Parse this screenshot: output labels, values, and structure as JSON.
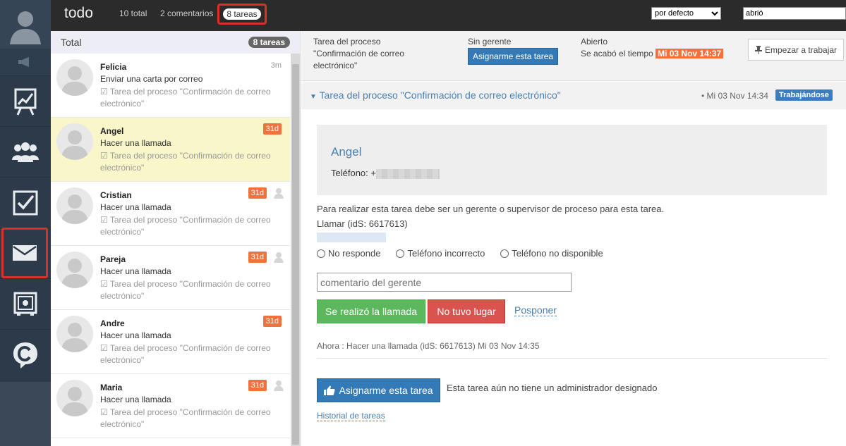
{
  "topbar": {
    "title": "todo",
    "total_label": "10 total",
    "comments_label": "2 comentarios",
    "tasks_label": "8 tareas",
    "sort_select_value": "por defecto",
    "search_value": "abrió"
  },
  "nav": {
    "items": [
      {
        "icon": "user-avatar-icon"
      },
      {
        "icon": "megaphone-icon"
      },
      {
        "icon": "chart-presentation-icon"
      },
      {
        "icon": "people-group-icon"
      },
      {
        "icon": "checkbox-icon"
      },
      {
        "icon": "envelope-icon",
        "active": true
      },
      {
        "icon": "safe-icon"
      },
      {
        "icon": "c-chat-icon"
      }
    ],
    "accent": "#d9302c"
  },
  "list": {
    "header_label": "Total",
    "header_count": "8 tareas",
    "items": [
      {
        "name": "Felicia",
        "action": "Enviar una carta por correo",
        "process": "Tarea del proceso \"Confirmación de correo electrónico\"",
        "time": "3m",
        "tag": "",
        "has_user_icon": false,
        "selected": false
      },
      {
        "name": "Angel",
        "action": "Hacer una llamada",
        "process": "Tarea del proceso \"Confirmación de correo electrónico\"",
        "time": "",
        "tag": "31d",
        "has_user_icon": false,
        "selected": true
      },
      {
        "name": "Cristian",
        "action": "Hacer una llamada",
        "process": "Tarea del proceso \"Confirmación de correo electrónico\"",
        "time": "",
        "tag": "31d",
        "has_user_icon": true,
        "selected": false
      },
      {
        "name": "Pareja",
        "action": "Hacer una llamada",
        "process": "Tarea del proceso \"Confirmación de correo electrónico\"",
        "time": "",
        "tag": "31d",
        "has_user_icon": true,
        "selected": false
      },
      {
        "name": "Andre",
        "action": "Hacer una llamada",
        "process": "Tarea del proceso \"Confirmación de correo electrónico\"",
        "time": "",
        "tag": "31d",
        "has_user_icon": false,
        "selected": false
      },
      {
        "name": "Maria",
        "action": "Hacer una llamada",
        "process": "Tarea del proceso \"Confirmación de correo electrónico\"",
        "time": "",
        "tag": "31d",
        "has_user_icon": true,
        "selected": false
      }
    ]
  },
  "detail": {
    "process_label": "Tarea del proceso",
    "process_name": "\"Confirmación de correo electrónico\"",
    "manager_label": "Sin gerente",
    "assign_small_label": "Asignarme esta tarea",
    "open_label": "Abierto",
    "timeout_label": "Se acabó el tiempo",
    "timeout_date": "Mi 03 Nov 14:37",
    "start_label": "Empezar a trabajar",
    "task_title": "Tarea del proceso \"Confirmación de correo electrónico\"",
    "task_date": "• Mi 03 Nov 14:34",
    "task_status": "Trabajándose",
    "contact_name": "Angel",
    "phone_label": "Teléfono: +",
    "description": "Para realizar esta tarea debe ser un gerente o supervisor de proceso para esta tarea.",
    "call_id": "Llamar (idS: 6617613)",
    "radio_options": [
      "No responde",
      "Teléfono incorrecto",
      "Teléfono no disponible"
    ],
    "comment_placeholder": "comentario del gerente",
    "btn_done": "Se realizó la llamada",
    "btn_not_happened": "No tuvo lugar",
    "postpone_label": "Posponer",
    "now_line": "Ahora : Hacer una llamada (idS: 6617613) Mi 03 Nov 14:35",
    "assign_label": "Asignarme esta tarea",
    "no_admin_text": "Esta tarea aún no tiene un administrador designado",
    "history_label": "Historial de tareas"
  }
}
